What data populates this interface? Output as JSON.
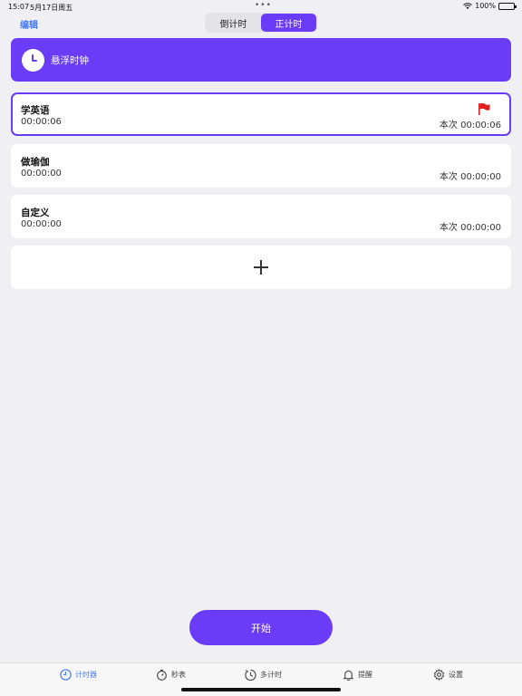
{
  "status": {
    "time": "15:07",
    "date": "5月17日周五",
    "battery": "100%"
  },
  "header": {
    "edit_label": "编辑",
    "segments": [
      {
        "label": "倒计时"
      },
      {
        "label": "正计时"
      }
    ],
    "active_segment": 1
  },
  "float_clock": {
    "label": "悬浮时钟"
  },
  "timers": [
    {
      "name": "学英语",
      "elapsed": "00:00:06",
      "session": "本次 00:00:06"
    },
    {
      "name": "做瑜伽",
      "elapsed": "00:00:00",
      "session": "本次 00:00:00"
    },
    {
      "name": "自定义",
      "elapsed": "00:00:00",
      "session": "本次 00:00:00"
    }
  ],
  "start_label": "开始",
  "tabs": [
    {
      "label": "计时器",
      "icon": "clock-icon"
    },
    {
      "label": "秒表",
      "icon": "stopwatch-icon"
    },
    {
      "label": "多计时",
      "icon": "multi-timer-icon"
    },
    {
      "label": "提醒",
      "icon": "bell-icon"
    },
    {
      "label": "设置",
      "icon": "gear-icon"
    }
  ],
  "colors": {
    "accent": "#6a3cf7",
    "link": "#4b7bf0",
    "flag": "#e02020",
    "background": "#efeff4"
  }
}
